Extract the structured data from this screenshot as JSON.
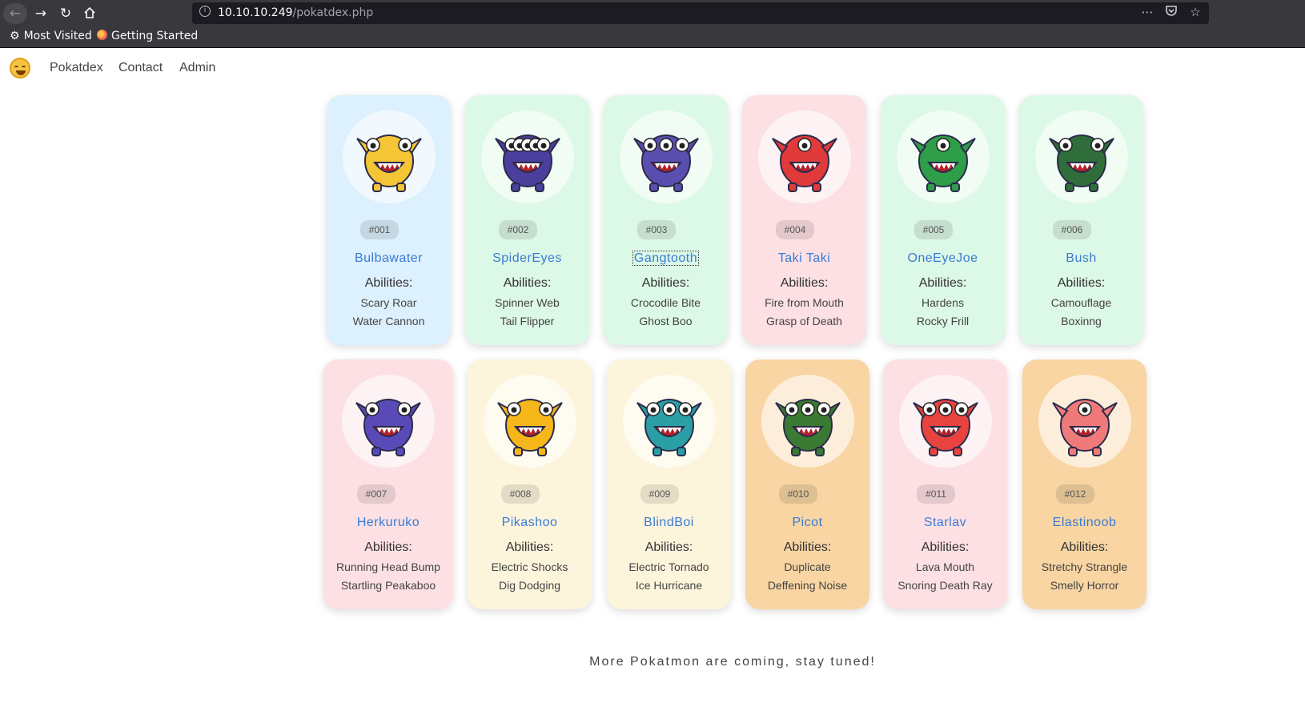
{
  "browser": {
    "url_host": "10.10.10.249",
    "url_path": "/pokatdex.php",
    "bookmarks": [
      "Most Visited",
      "Getting Started"
    ]
  },
  "site": {
    "nav": [
      "Pokatdex",
      "Contact",
      "Admin"
    ]
  },
  "cards": [
    {
      "number": "#001",
      "name": "Bulbawater",
      "abilities_label": "Abilities:",
      "abilities": [
        "Scary Roar",
        "Water Cannon"
      ],
      "theme": "blue",
      "body_color": "#f4c534"
    },
    {
      "number": "#002",
      "name": "SpiderEyes",
      "abilities_label": "Abilities:",
      "abilities": [
        "Spinner Web",
        "Tail Flipper"
      ],
      "theme": "green",
      "body_color": "#4b3f9e"
    },
    {
      "number": "#003",
      "name": "Gangtooth",
      "abilities_label": "Abilities:",
      "abilities": [
        "Crocodile Bite",
        "Ghost Boo"
      ],
      "theme": "green",
      "body_color": "#5a4fb0"
    },
    {
      "number": "#004",
      "name": "Taki Taki",
      "abilities_label": "Abilities:",
      "abilities": [
        "Fire from Mouth",
        "Grasp of Death"
      ],
      "theme": "pink",
      "body_color": "#e03a3a"
    },
    {
      "number": "#005",
      "name": "OneEyeJoe",
      "abilities_label": "Abilities:",
      "abilities": [
        "Hardens",
        "Rocky Frill"
      ],
      "theme": "green",
      "body_color": "#2e9e48"
    },
    {
      "number": "#006",
      "name": "Bush",
      "abilities_label": "Abilities:",
      "abilities": [
        "Camouflage",
        "Boxinng"
      ],
      "theme": "green",
      "body_color": "#2f6e3a"
    },
    {
      "number": "#007",
      "name": "Herkuruko",
      "abilities_label": "Abilities:",
      "abilities": [
        "Running Head Bump",
        "Startling Peakaboo"
      ],
      "theme": "pink",
      "body_color": "#5a4ab8"
    },
    {
      "number": "#008",
      "name": "Pikashoo",
      "abilities_label": "Abilities:",
      "abilities": [
        "Electric Shocks",
        "Dig Dodging"
      ],
      "theme": "yellow",
      "body_color": "#f5b71a"
    },
    {
      "number": "#009",
      "name": "BlindBoi",
      "abilities_label": "Abilities:",
      "abilities": [
        "Electric Tornado",
        "Ice Hurricane"
      ],
      "theme": "yellow",
      "body_color": "#2a9fa6"
    },
    {
      "number": "#010",
      "name": "Picot",
      "abilities_label": "Abilities:",
      "abilities": [
        "Duplicate",
        "Deffening Noise"
      ],
      "theme": "orange",
      "body_color": "#3a7a32"
    },
    {
      "number": "#011",
      "name": "Starlav",
      "abilities_label": "Abilities:",
      "abilities": [
        "Lava Mouth",
        "Snoring Death Ray"
      ],
      "theme": "pink",
      "body_color": "#e8433f"
    },
    {
      "number": "#012",
      "name": "Elastinoob",
      "abilities_label": "Abilities:",
      "abilities": [
        "Stretchy Strangle",
        "Smelly Horror"
      ],
      "theme": "orange",
      "body_color": "#f07a7a"
    }
  ],
  "footer_text": "More Pokatmon are coming, stay tuned!"
}
